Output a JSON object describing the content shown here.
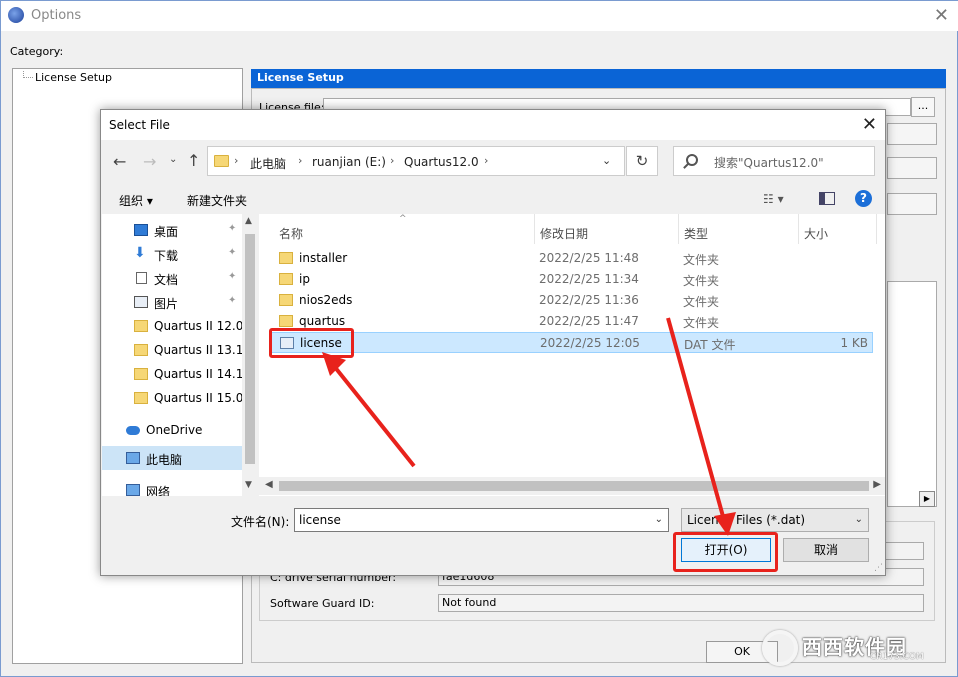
{
  "options_window": {
    "title": "Options",
    "close_glyph": "✕",
    "category_label": "Category:",
    "tree_item": "License Setup",
    "panel_title": "License Setup",
    "license_file_label": "License file:",
    "browse_label": "...",
    "rows": [
      {
        "label": "C: drive serial number:",
        "value": "fae1d608"
      },
      {
        "label": "Software Guard ID:",
        "value": "Not found"
      }
    ],
    "ok_label": "OK"
  },
  "watermark": {
    "text": "西西软件园",
    "sub": "CR173.COM"
  },
  "dialog": {
    "title": "Select File",
    "close_glyph": "✕",
    "nav": {
      "back": "←",
      "forward": "→",
      "dropdown": "⌄",
      "up": "↑"
    },
    "breadcrumb": [
      "此电脑",
      "ruanjian (E:)",
      "Quartus12.0"
    ],
    "crumb_sep": "›",
    "address_dropdown": "⌄",
    "refresh_glyph": "↻",
    "search_placeholder": "搜索\"Quartus12.0\"",
    "toolbar": {
      "organize": "组织 ▾",
      "new_folder": "新建文件夹",
      "view": "☷ ▾",
      "help": "?"
    },
    "nav_items": [
      {
        "label": "桌面",
        "icon": "desktop-icon",
        "pinned": true
      },
      {
        "label": "下载",
        "icon": "download-icon",
        "pinned": true
      },
      {
        "label": "文档",
        "icon": "document-icon",
        "pinned": true
      },
      {
        "label": "图片",
        "icon": "picture-icon",
        "pinned": true
      },
      {
        "label": "Quartus II 12.0",
        "icon": "folder-icon",
        "pinned": false
      },
      {
        "label": "Quartus II 13.1",
        "icon": "folder-icon",
        "pinned": false
      },
      {
        "label": "Quartus II 14.1",
        "icon": "folder-icon",
        "pinned": false
      },
      {
        "label": "Quartus II 15.0",
        "icon": "folder-icon",
        "pinned": false
      },
      {
        "label": "OneDrive",
        "icon": "cloud-icon",
        "pinned": false
      },
      {
        "label": "此电脑",
        "icon": "computer-icon",
        "pinned": false,
        "selected": true
      },
      {
        "label": "网络",
        "icon": "network-icon",
        "pinned": false
      }
    ],
    "pin_glyph": "📌",
    "columns": {
      "name": "名称",
      "date": "修改日期",
      "type": "类型",
      "size": "大小"
    },
    "files": [
      {
        "name": "installer",
        "date": "2022/2/25 11:48",
        "type": "文件夹",
        "size": "",
        "kind": "folder"
      },
      {
        "name": "ip",
        "date": "2022/2/25 11:34",
        "type": "文件夹",
        "size": "",
        "kind": "folder"
      },
      {
        "name": "nios2eds",
        "date": "2022/2/25 11:36",
        "type": "文件夹",
        "size": "",
        "kind": "folder"
      },
      {
        "name": "quartus",
        "date": "2022/2/25 11:47",
        "type": "文件夹",
        "size": "",
        "kind": "folder"
      },
      {
        "name": "license",
        "date": "2022/2/25 12:05",
        "type": "DAT 文件",
        "size": "1 KB",
        "kind": "dat",
        "selected": true
      }
    ],
    "filename_label": "文件名(N):",
    "filename_value": "license",
    "filetype_value": "License Files (*.dat)",
    "open_label": "打开(O)",
    "cancel_label": "取消"
  },
  "colors": {
    "accent": "#0078d7",
    "annotation_red": "#e8221c",
    "panel_header": "#0a64d6",
    "selection": "#cce8ff"
  }
}
